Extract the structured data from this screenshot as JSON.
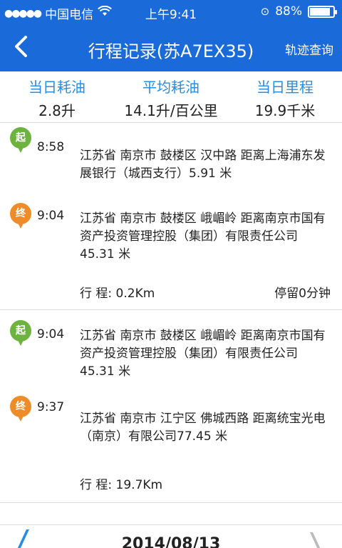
{
  "status_bar": {
    "carrier": "中国电信",
    "time": "上午9:41",
    "battery": "88%",
    "battery_level": 0.88
  },
  "nav": {
    "back_icon": "chevron-left",
    "title": "行程记录(苏A7EX35)",
    "track_label": "轨迹查询"
  },
  "stats": [
    {
      "label": "当日耗油",
      "value": "2.8升"
    },
    {
      "label": "平均耗油",
      "value": "14.1升/百公里"
    },
    {
      "label": "当日里程",
      "value": "19.9千米"
    }
  ],
  "trips": [
    {
      "start": {
        "badge": "起",
        "time": "8:58",
        "address": "江苏省 南京市 鼓楼区 汉中路  距离上海浦东发展银行（城西支行）5.91 米"
      },
      "end": {
        "badge": "终",
        "time": "9:04",
        "address": "江苏省 南京市 鼓楼区 峨嵋岭  距离南京市国有资产投资管理控股（集团）有限责任公司45.31 米"
      },
      "distance": "行 程:  0.2Km",
      "stay": "停留0分钟"
    },
    {
      "start": {
        "badge": "起",
        "time": "9:04",
        "address": "江苏省 南京市 鼓楼区 峨嵋岭  距离南京市国有资产投资管理控股（集团）有限责任公司45.31 米"
      },
      "end": {
        "badge": "终",
        "time": "9:37",
        "address": "江苏省 南京市 江宁区 佛城西路  距离统宝光电（南京）有限公司77.45 米"
      },
      "distance": "行 程:  19.7Km",
      "stay": ""
    }
  ],
  "footer": {
    "date": "2014/08/13"
  }
}
